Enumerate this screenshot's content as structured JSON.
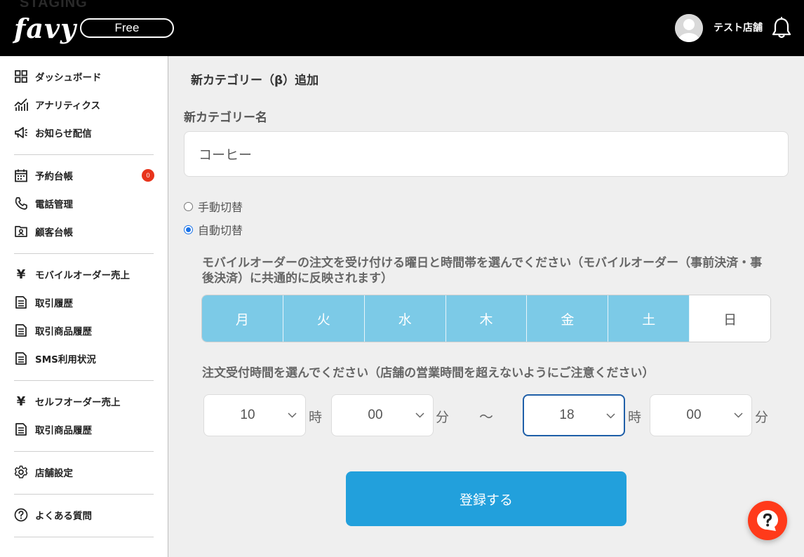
{
  "header": {
    "env_label": "STAGING",
    "logo_text": "favy",
    "plan_badge": "Free",
    "store_name": "テスト店舗"
  },
  "sidebar": {
    "items": [
      {
        "label": "ダッシュボード",
        "icon": "dashboard-icon"
      },
      {
        "label": "アナリティクス",
        "icon": "analytics-icon"
      },
      {
        "label": "お知らせ配信",
        "icon": "megaphone-icon"
      },
      {
        "label": "予約台帳",
        "icon": "calendar-icon",
        "badge": "0"
      },
      {
        "label": "電話管理",
        "icon": "phone-icon"
      },
      {
        "label": "顧客台帳",
        "icon": "contact-card-icon"
      },
      {
        "label": "モバイルオーダー売上",
        "icon": "yen-icon"
      },
      {
        "label": "取引履歴",
        "icon": "document-icon"
      },
      {
        "label": "取引商品履歴",
        "icon": "document-icon"
      },
      {
        "label": "SMS利用状況",
        "icon": "document-icon"
      },
      {
        "label": "セルフオーダー売上",
        "icon": "yen-icon"
      },
      {
        "label": "取引商品履歴",
        "icon": "document-icon"
      },
      {
        "label": "店舗設定",
        "icon": "gear-icon"
      },
      {
        "label": "よくある質問",
        "icon": "question-icon"
      }
    ]
  },
  "main": {
    "page_title": "新カテゴリー（β）追加",
    "category_name_label": "新カテゴリー名",
    "category_name_value": "コーヒー",
    "switch_options": [
      {
        "label": "手動切替",
        "checked": false
      },
      {
        "label": "自動切替",
        "checked": true
      }
    ],
    "days_instruction": "モバイルオーダーの注文を受け付ける曜日と時間帯を選んでください（モバイルオーダー（事前決済・事後決済）に共通的に反映されます）",
    "days": [
      {
        "label": "月",
        "selected": true
      },
      {
        "label": "火",
        "selected": true
      },
      {
        "label": "水",
        "selected": true
      },
      {
        "label": "木",
        "selected": true
      },
      {
        "label": "金",
        "selected": true
      },
      {
        "label": "土",
        "selected": true
      },
      {
        "label": "日",
        "selected": false
      }
    ],
    "time_instruction": "注文受付時間を選んでください（店舗の営業時間を超えないようにご注意ください）",
    "time": {
      "start_hour": "10",
      "start_minute": "00",
      "end_hour": "18",
      "end_minute": "00",
      "hour_unit": "時",
      "minute_unit": "分",
      "separator": "〜"
    },
    "submit_label": "登録する"
  },
  "colors": {
    "header_bg": "#000000",
    "day_selected": "#7ccae7",
    "submit_button": "#22a0dc",
    "badge_red": "#e8341c",
    "help_fab": "#ff3a1a",
    "focus_border": "#1f5fa8"
  }
}
